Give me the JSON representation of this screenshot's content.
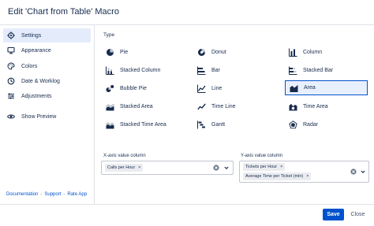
{
  "dialog": {
    "title": "Edit 'Chart from Table' Macro"
  },
  "sidebar": {
    "items": [
      {
        "label": "Settings",
        "icon": "gear-icon"
      },
      {
        "label": "Appearance",
        "icon": "monitor-icon"
      },
      {
        "label": "Colors",
        "icon": "palette-icon"
      },
      {
        "label": "Date & Worklog",
        "icon": "clock-icon"
      },
      {
        "label": "Adjustments",
        "icon": "sliders-icon"
      },
      {
        "label": "Show Preview",
        "icon": "eye-icon"
      }
    ],
    "active": "Settings",
    "footer": {
      "documentation": "Documentation",
      "support": "Support",
      "rate": "Rate App",
      "separator": "-"
    }
  },
  "main": {
    "type_label": "Type",
    "types": [
      {
        "label": "Pie",
        "icon": "pie-icon"
      },
      {
        "label": "Donut",
        "icon": "donut-icon"
      },
      {
        "label": "Column",
        "icon": "column-chart-icon"
      },
      {
        "label": "Stacked Column",
        "icon": "stacked-column-icon"
      },
      {
        "label": "Bar",
        "icon": "bar-chart-icon"
      },
      {
        "label": "Stacked Bar",
        "icon": "stacked-bar-icon"
      },
      {
        "label": "Bubble Pie",
        "icon": "bubble-pie-icon"
      },
      {
        "label": "Line",
        "icon": "line-chart-icon"
      },
      {
        "label": "Area",
        "icon": "area-chart-icon"
      },
      {
        "label": "Stacked Area",
        "icon": "stacked-area-icon"
      },
      {
        "label": "Time Line",
        "icon": "time-line-icon"
      },
      {
        "label": "Time Area",
        "icon": "time-area-icon"
      },
      {
        "label": "Stacked Time Area",
        "icon": "stacked-time-area-icon"
      },
      {
        "label": "Gantt",
        "icon": "gantt-icon"
      },
      {
        "label": "Radar",
        "icon": "radar-icon"
      }
    ],
    "selected_type": "Area",
    "x_axis": {
      "label": "X-axis value column",
      "tags": [
        "Calls per Hour"
      ]
    },
    "y_axis": {
      "label": "Y-axis value column",
      "tags": [
        "Tickets per Hour",
        "Average Time per Ticket (min)"
      ]
    },
    "tag_remove": "×"
  },
  "buttons": {
    "save": "Save",
    "close": "Close"
  },
  "colors": {
    "primary": "#0052cc",
    "selected_bg": "#e9f0fd",
    "sidebar_active": "#e4ecfc",
    "text": "#172b4d"
  }
}
